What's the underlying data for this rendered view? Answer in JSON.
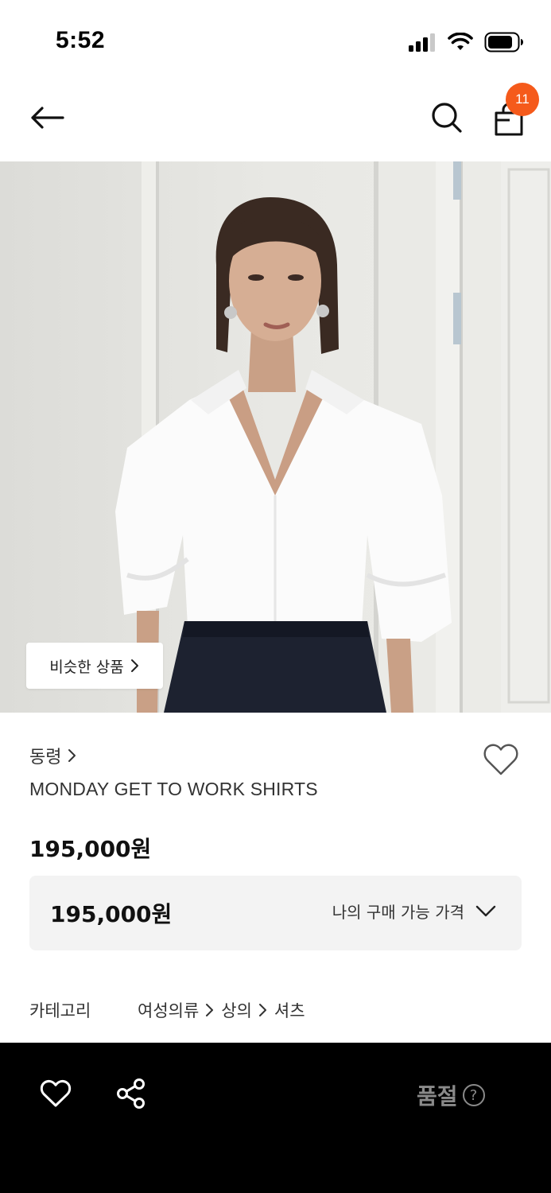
{
  "status_bar": {
    "time": "5:52"
  },
  "header": {
    "back_icon": "arrow-left-icon",
    "search_icon": "search-icon",
    "cart_icon": "shopping-bag-icon",
    "cart_count": "11",
    "badge_color": "#f55a1b"
  },
  "product": {
    "similar_button_label": "비슷한 상품",
    "brand": "동령",
    "name": "MONDAY GET TO WORK SHIRTS",
    "price": "195,000원",
    "my_price": {
      "value": "195,000원",
      "label": "나의 구매 가능 가격"
    },
    "category": {
      "title": "카테고리",
      "path": [
        "여성의류",
        "상의",
        "셔츠"
      ]
    }
  },
  "bottom_bar": {
    "like_icon": "heart-icon",
    "share_icon": "share-icon",
    "status_label": "품절",
    "help_icon": "question-circle-icon"
  }
}
